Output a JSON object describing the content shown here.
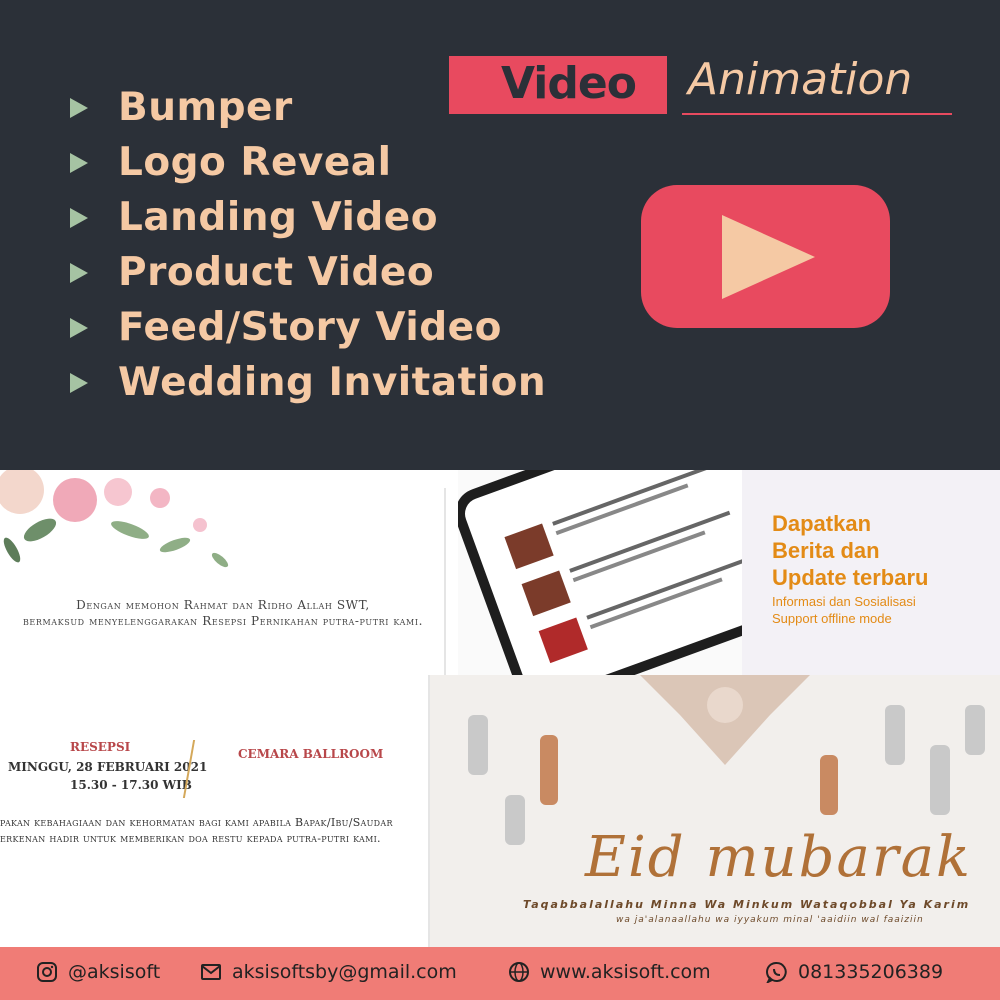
{
  "header": {
    "badge_label": "Video",
    "subtitle": "Animation"
  },
  "services": [
    {
      "label": "Bumper"
    },
    {
      "label": "Logo Reveal"
    },
    {
      "label": "Landing Video"
    },
    {
      "label": "Product Video"
    },
    {
      "label": "Feed/Story Video"
    },
    {
      "label": "Wedding Invitation"
    }
  ],
  "samples": {
    "wedding_top": {
      "line1": "Dengan memohon Rahmat dan Ridho Allah SWT,",
      "line2": "bermaksud menyelenggarakan Resepsi Pernikahan putra-putri kami."
    },
    "wedding_bottom": {
      "event": "RESEPSI",
      "date": "MINGGU, 28 FEBRUARI 2021",
      "time": "15.30 - 17.30 WIB",
      "venue": "CEMARA BALLROOM",
      "msg1": "pakan kebahagiaan dan kehormatan bagi kami apabila Bapak/Ibu/Saudar",
      "msg2": "erkenan hadir untuk memberikan doa restu kepada putra-putri kami."
    },
    "promo": {
      "headline_1": "Dapatkan",
      "headline_2": "Berita dan",
      "headline_3": "Update terbaru",
      "sub_1": "Informasi dan Sosialisasi",
      "sub_2": "Support offline mode"
    },
    "eid": {
      "title": "Eid mubarak",
      "subtitle": "Taqabbalallahu Minna Wa Minkum Wataqobbal Ya Karim",
      "subtitle2": "wa ja'alanaallahu wa iyyakum minal 'aaidiin wal faaiziin"
    }
  },
  "footer": {
    "instagram": "@aksisoft",
    "email": "aksisoftsby@gmail.com",
    "website": "www.aksisoft.com",
    "whatsapp": "081335206389"
  },
  "colors": {
    "background": "#2b3038",
    "accent": "#e84a5f",
    "text_peach": "#f5c9a4",
    "bullet": "#a6c3a3",
    "footer": "#f07c76"
  }
}
